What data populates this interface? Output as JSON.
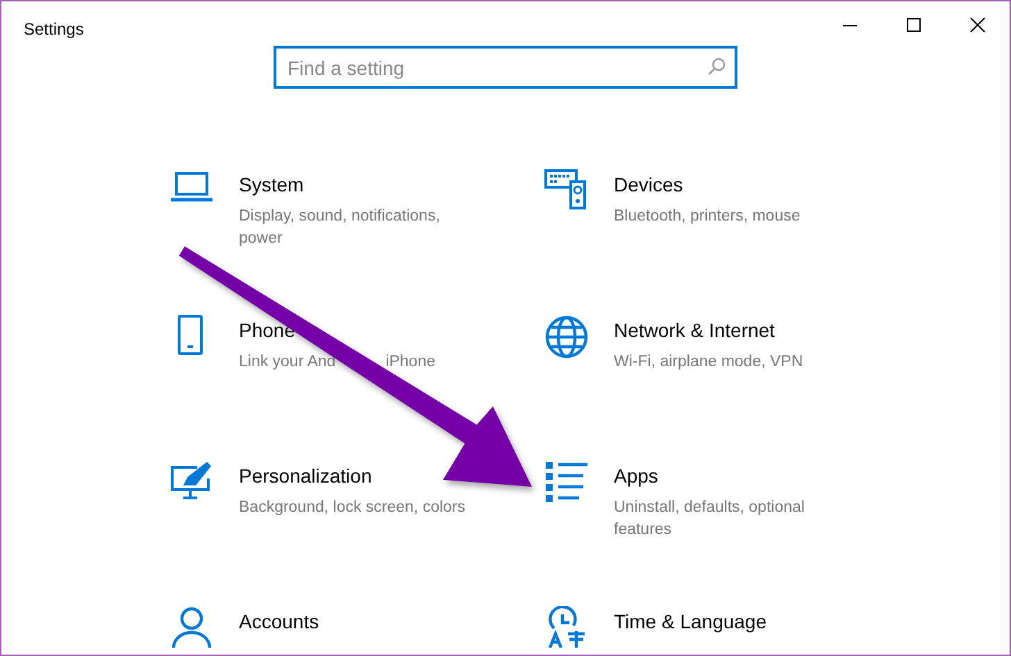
{
  "window": {
    "title": "Settings"
  },
  "search": {
    "placeholder": "Find a setting"
  },
  "categories": [
    {
      "kind": "laptop",
      "title": "System",
      "description": [
        "Display, sound, notifications, power"
      ]
    },
    {
      "kind": "keyboard",
      "title": "Devices",
      "description": [
        "Bluetooth, printers, mouse"
      ]
    },
    {
      "kind": "phone",
      "title": "Phone",
      "description": [
        "Link your And",
        "iPhone"
      ]
    },
    {
      "kind": "globe",
      "title": "Network & Internet",
      "description": [
        "Wi-Fi, airplane mode, VPN"
      ]
    },
    {
      "kind": "brush",
      "title": "Personalization",
      "description": [
        "Background, lock screen, colors"
      ]
    },
    {
      "kind": "list",
      "title": "Apps",
      "description": [
        "Uninstall, defaults, optional features"
      ]
    },
    {
      "kind": "person",
      "title": "Accounts"
    },
    {
      "kind": "language",
      "title": "Time & Language"
    }
  ]
}
